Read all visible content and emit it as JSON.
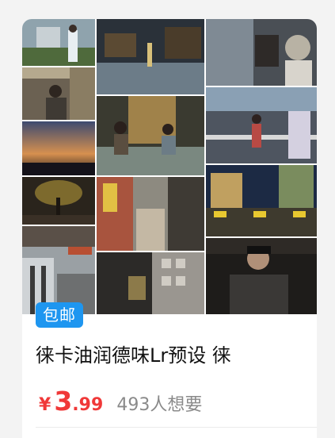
{
  "product": {
    "badge": "包邮",
    "title": "徕卡油润德味Lr预设 徕",
    "price": {
      "currency": "¥",
      "integer": "3",
      "decimal": ".99"
    },
    "want_count": "493人想要"
  },
  "colors": {
    "badge_bg": "#1e96f0",
    "price": "#f03838",
    "muted": "#8a8a8a"
  },
  "collage": {
    "photos": [
      "street-portrait-photo",
      "plaza-night-photo",
      "sidewalk-evening-photo",
      "parked-bike-photo",
      "hallway-man-photo",
      "cafe-couple-photo",
      "crosswalk-skater-photo",
      "dusk-sky-photo",
      "lit-tree-photo",
      "graffiti-alley-photo",
      "city-buildings-photo",
      "taxi-street-photo",
      "atm-street-photo",
      "metal-gate-photo",
      "man-phone-photo"
    ]
  }
}
